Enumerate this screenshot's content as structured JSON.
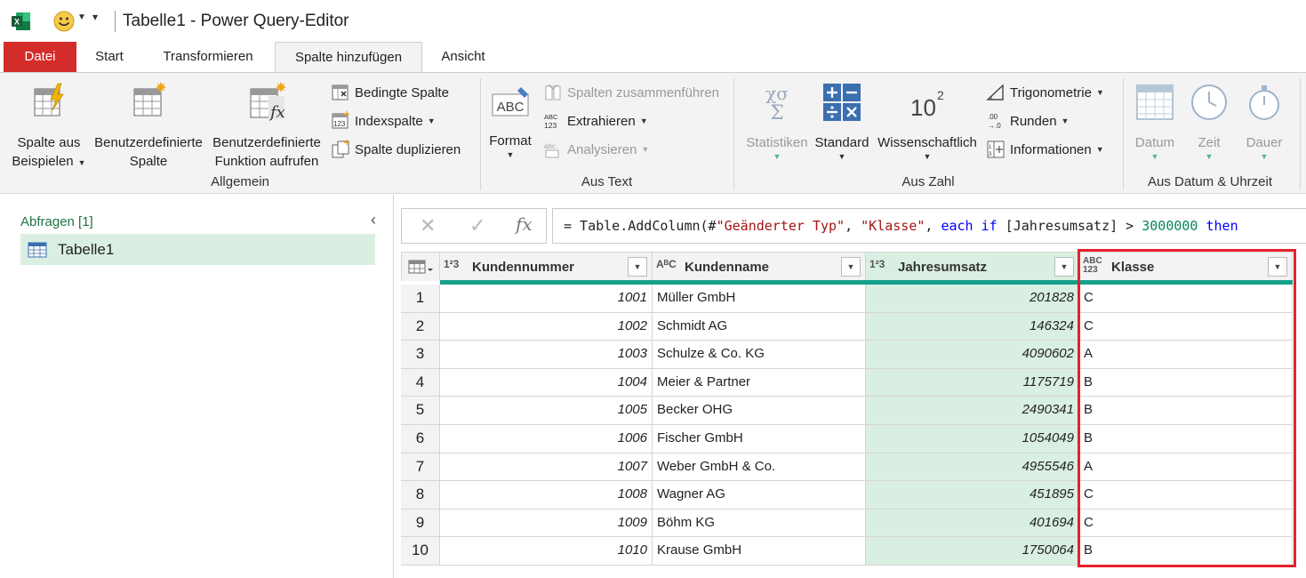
{
  "window": {
    "title": "Tabelle1 - Power Query-Editor"
  },
  "tabs": [
    {
      "label": "Datei"
    },
    {
      "label": "Start"
    },
    {
      "label": "Transformieren"
    },
    {
      "label": "Spalte hinzufügen"
    },
    {
      "label": "Ansicht"
    }
  ],
  "ribbon": {
    "general": {
      "label": "Allgemein",
      "example_line1": "Spalte aus",
      "example_line2": "Beispielen",
      "custom_line1": "Benutzerdefinierte",
      "custom_line2": "Spalte",
      "invoke_line1": "Benutzerdefinierte",
      "invoke_line2": "Funktion aufrufen",
      "conditional": "Bedingte Spalte",
      "index": "Indexspalte",
      "duplicate": "Spalte duplizieren"
    },
    "text": {
      "label": "Aus Text",
      "format": "Format",
      "merge": "Spalten zusammenführen",
      "extract": "Extrahieren",
      "parse": "Analysieren"
    },
    "number": {
      "label": "Aus Zahl",
      "statistics": "Statistiken",
      "standard": "Standard",
      "scientific": "Wissenschaftlich",
      "trig": "Trigonometrie",
      "rounding": "Runden",
      "info": "Informationen"
    },
    "datetime": {
      "label": "Aus Datum & Uhrzeit",
      "date": "Datum",
      "time": "Zeit",
      "duration": "Dauer"
    }
  },
  "queries": {
    "header": "Abfragen [1]",
    "items": [
      {
        "name": "Tabelle1"
      }
    ]
  },
  "formula": {
    "p1": "= Table.AddColumn(#",
    "p2": "\"Geänderter Typ\"",
    "p3": ", ",
    "p4": "\"Klasse\"",
    "p5": ", ",
    "p6": "each",
    "p7": " ",
    "p8": "if",
    "p9": " [Jahresumsatz] > ",
    "p10": "3000000",
    "p11": " ",
    "p12": "then"
  },
  "table": {
    "columns": [
      {
        "type": "1²3",
        "name": "Kundennummer"
      },
      {
        "type": "AᴮC",
        "name": "Kundenname"
      },
      {
        "type": "1²3",
        "name": "Jahresumsatz"
      },
      {
        "type": "ABC 123",
        "name": "Klasse"
      }
    ],
    "rows": [
      {
        "idx": "1",
        "num": "1001",
        "name": "Müller GmbH",
        "ums": "201828",
        "kl": "C"
      },
      {
        "idx": "2",
        "num": "1002",
        "name": "Schmidt AG",
        "ums": "146324",
        "kl": "C"
      },
      {
        "idx": "3",
        "num": "1003",
        "name": "Schulze & Co. KG",
        "ums": "4090602",
        "kl": "A"
      },
      {
        "idx": "4",
        "num": "1004",
        "name": "Meier & Partner",
        "ums": "1175719",
        "kl": "B"
      },
      {
        "idx": "5",
        "num": "1005",
        "name": "Becker OHG",
        "ums": "2490341",
        "kl": "B"
      },
      {
        "idx": "6",
        "num": "1006",
        "name": "Fischer GmbH",
        "ums": "1054049",
        "kl": "B"
      },
      {
        "idx": "7",
        "num": "1007",
        "name": "Weber GmbH & Co.",
        "ums": "4955546",
        "kl": "A"
      },
      {
        "idx": "8",
        "num": "1008",
        "name": "Wagner AG",
        "ums": "451895",
        "kl": "C"
      },
      {
        "idx": "9",
        "num": "1009",
        "name": "Böhm KG",
        "ums": "401694",
        "kl": "C"
      },
      {
        "idx": "10",
        "num": "1010",
        "name": "Krause GmbH",
        "ums": "1750064",
        "kl": "B"
      }
    ]
  },
  "colors": {
    "file_tab": "#d42b2b",
    "accent": "#217346",
    "teal": "#15a08a",
    "highlight": "#e8202a"
  }
}
